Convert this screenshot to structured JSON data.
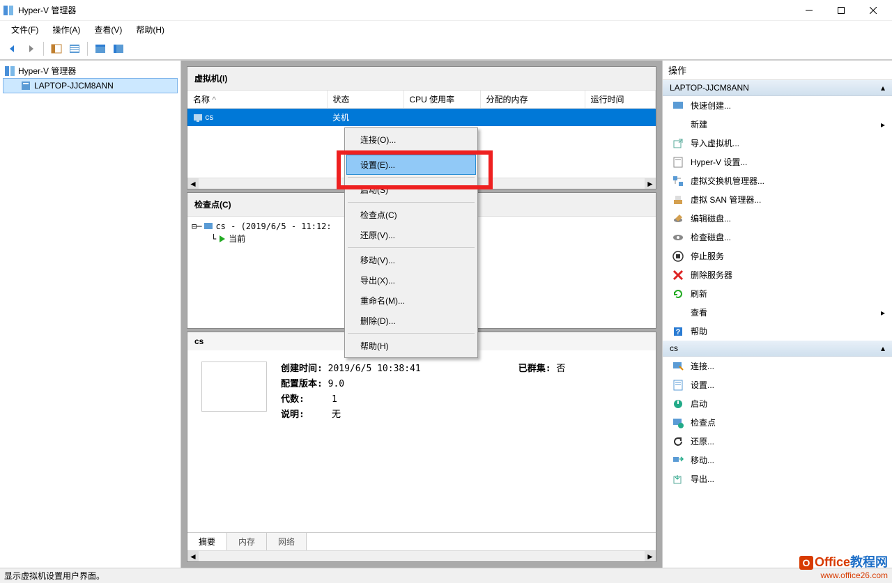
{
  "title": "Hyper-V 管理器",
  "menubar": [
    "文件(F)",
    "操作(A)",
    "查看(V)",
    "帮助(H)"
  ],
  "tree": {
    "root": "Hyper-V 管理器",
    "child": "LAPTOP-JJCM8ANN"
  },
  "vm_panel": {
    "title": "虚拟机(I)",
    "columns": [
      "名称",
      "状态",
      "CPU 使用率",
      "分配的内存",
      "运行时间"
    ],
    "row": {
      "name": "cs",
      "status": "关机"
    }
  },
  "checkpoint_panel": {
    "title": "检查点(C)",
    "node": "cs - (2019/6/5 - 11:12:",
    "current": "当前"
  },
  "details_panel": {
    "title": "cs",
    "created_label": "创建时间:",
    "created_value": "2019/6/5 10:38:41",
    "clustered_label": "已群集:",
    "clustered_value": "否",
    "config_label": "配置版本:",
    "config_value": "9.0",
    "gen_label": "代数:",
    "gen_value": "1",
    "desc_label": "说明:",
    "desc_value": "无",
    "tabs": [
      "摘要",
      "内存",
      "网络"
    ]
  },
  "context_menu": [
    "连接(O)...",
    "设置(E)...",
    "启动(S)",
    "检查点(C)",
    "还原(V)...",
    "移动(V)...",
    "导出(X)...",
    "重命名(M)...",
    "删除(D)...",
    "帮助(H)"
  ],
  "actions": {
    "title": "操作",
    "section1": "LAPTOP-JJCM8ANN",
    "items1": [
      "快速创建...",
      "新建",
      "导入虚拟机...",
      "Hyper-V 设置...",
      "虚拟交换机管理器...",
      "虚拟 SAN 管理器...",
      "编辑磁盘...",
      "检查磁盘...",
      "停止服务",
      "删除服务器",
      "刷新",
      "查看",
      "帮助"
    ],
    "section2": "cs",
    "items2": [
      "连接...",
      "设置...",
      "启动",
      "检查点",
      "还原...",
      "移动...",
      "导出..."
    ]
  },
  "statusbar": "显示虚拟机设置用户界面。",
  "watermark": {
    "brand": "Office教程网",
    "url": "www.office26.com"
  }
}
